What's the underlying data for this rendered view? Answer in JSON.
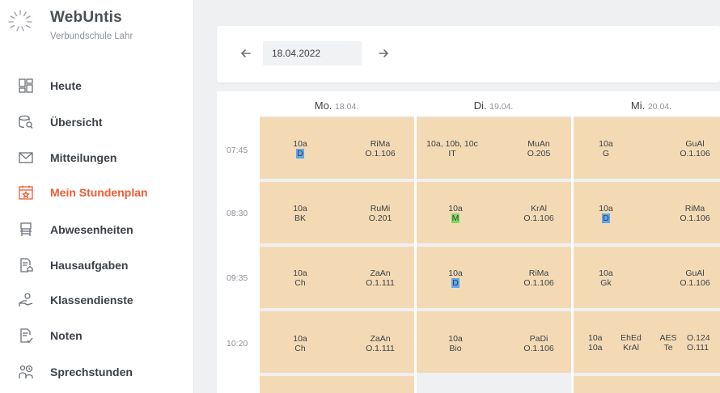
{
  "brand": {
    "title": "WebUntis",
    "subtitle": "Verbundschule Lahr"
  },
  "nav": [
    {
      "label": "Heute",
      "icon": "dashboard-icon",
      "active": false
    },
    {
      "label": "Übersicht",
      "icon": "overview-icon",
      "active": false
    },
    {
      "label": "Mitteilungen",
      "icon": "mail-icon",
      "active": false
    },
    {
      "label": "Mein Stundenplan",
      "icon": "calendar-icon",
      "active": true
    },
    {
      "label": "Abwesenheiten",
      "icon": "chair-icon",
      "active": false
    },
    {
      "label": "Hausaufgaben",
      "icon": "homework-icon",
      "active": false
    },
    {
      "label": "Klassendienste",
      "icon": "class-duty-icon",
      "active": false
    },
    {
      "label": "Noten",
      "icon": "grades-icon",
      "active": false
    },
    {
      "label": "Sprechstunden",
      "icon": "consultation-icon",
      "active": false
    }
  ],
  "colors": {
    "accent": "#f15b32",
    "lesson": "#f4dab4",
    "highlight_blue": "#5fa5ef",
    "highlight_green": "#7fd95c"
  },
  "toolbar": {
    "date": "18.04.2022",
    "prev_icon": "arrow-left-icon",
    "next_icon": "arrow-right-icon"
  },
  "days": [
    {
      "name": "Mo.",
      "date": "18.04."
    },
    {
      "name": "Di.",
      "date": "19.04."
    },
    {
      "name": "Mi.",
      "date": "20.04."
    }
  ],
  "times": [
    "07:45",
    "08:30",
    "09:35",
    "10:20"
  ],
  "lessons": {
    "mo": [
      {
        "klasse": "10a",
        "fach": "D",
        "lehrer": "RiMa",
        "raum": "O.1.106"
      },
      {
        "klasse": "10a",
        "fach": "BK",
        "lehrer": "RuMi",
        "raum": "O.201"
      },
      {
        "klasse": "10a",
        "fach": "Ch",
        "lehrer": "ZaAn",
        "raum": "O.1.111"
      },
      {
        "klasse": "10a",
        "fach": "Ch",
        "lehrer": "ZaAn",
        "raum": "O.1.111"
      }
    ],
    "di": [
      {
        "klasse": "10a, 10b, 10c",
        "fach": "IT",
        "lehrer": "MuAn",
        "raum": "O.205"
      },
      {
        "klasse": "10a",
        "fach": "M",
        "lehrer": "KrAl",
        "raum": "O.1.106"
      },
      {
        "klasse": "10a",
        "fach": "D",
        "lehrer": "RiMa",
        "raum": "O.1.106"
      },
      {
        "klasse": "10a",
        "fach": "Bio",
        "lehrer": "PaDi",
        "raum": "O.1.106"
      }
    ],
    "mi": [
      {
        "klasse": "10a",
        "fach": "G",
        "lehrer": "GuAl",
        "raum": "O.1.106"
      },
      {
        "klasse": "10a",
        "fach": "D",
        "lehrer": "RiMa",
        "raum": "O.1.106"
      },
      {
        "klasse": "10a",
        "fach": "Gk",
        "lehrer": "GuAl",
        "raum": "O.1.106"
      }
    ],
    "mi_split": {
      "a": {
        "klasse": "10a",
        "lehrer": "EhEd",
        "fach": "AES",
        "raum": "O.124"
      },
      "b": {
        "klasse": "10a",
        "lehrer": "KrAl",
        "fach": "Te",
        "raum": "O.111"
      }
    }
  }
}
